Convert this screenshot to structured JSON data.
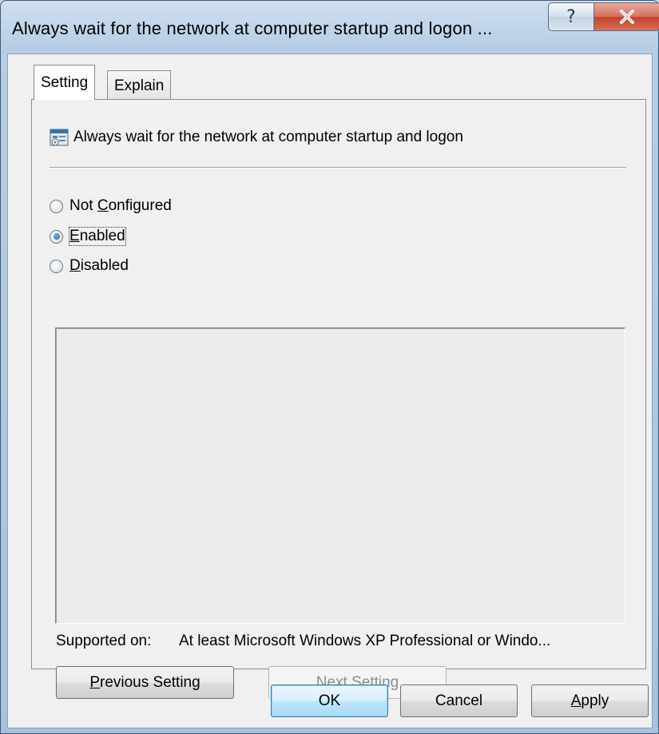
{
  "window": {
    "title": "Always wait for the network at computer startup and logon ...",
    "help_glyph": "?",
    "close_icon": "close-icon"
  },
  "tabs": [
    {
      "label": "Setting",
      "selected": true
    },
    {
      "label": "Explain",
      "selected": false
    }
  ],
  "setting": {
    "policy_icon": "policy-setting-icon",
    "heading": "Always wait for the network at computer startup and logon",
    "radios": [
      {
        "label": "Not Configured",
        "accel": "C",
        "checked": false
      },
      {
        "label": "Enabled",
        "accel": "E",
        "checked": true
      },
      {
        "label": "Disabled",
        "accel": "D",
        "checked": false
      }
    ],
    "supported_on_label": "Supported on:",
    "supported_on_value": "At least Microsoft Windows XP Professional or Windo..."
  },
  "buttons": {
    "previous": "Previous Setting",
    "next": "Next Setting",
    "ok": "OK",
    "cancel": "Cancel",
    "apply": "Apply"
  },
  "colors": {
    "close_button": "#c2412a",
    "radio_checked": "#1b5fa8",
    "default_button_border": "#3c7fb1"
  }
}
